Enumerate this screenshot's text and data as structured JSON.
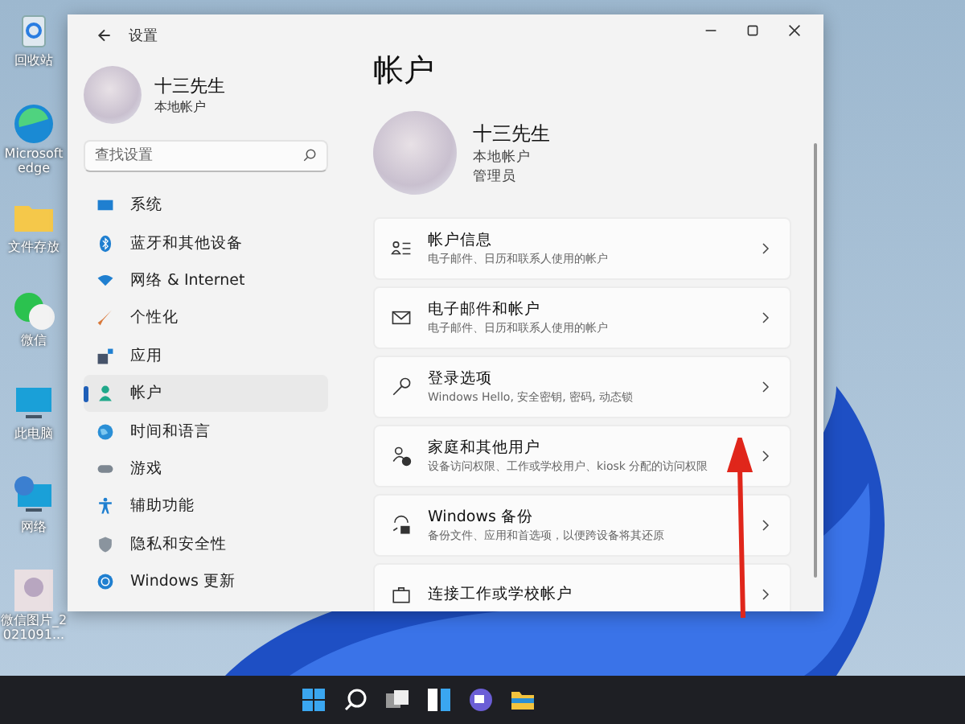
{
  "desktop_icons": [
    {
      "label": "回收站"
    },
    {
      "label": "Microsoft edge"
    },
    {
      "label": "文件存放"
    },
    {
      "label": "微信"
    },
    {
      "label": "此电脑"
    },
    {
      "label": "网络"
    },
    {
      "label": "微信图片_2021091..."
    }
  ],
  "window": {
    "title": "设置"
  },
  "sidebar": {
    "user": {
      "name": "十三先生",
      "account_type": "本地帐户"
    },
    "search": {
      "placeholder": "查找设置"
    },
    "items": [
      {
        "label": "系统",
        "selected": false
      },
      {
        "label": "蓝牙和其他设备",
        "selected": false
      },
      {
        "label": "网络 & Internet",
        "selected": false
      },
      {
        "label": "个性化",
        "selected": false
      },
      {
        "label": "应用",
        "selected": false
      },
      {
        "label": "帐户",
        "selected": true
      },
      {
        "label": "时间和语言",
        "selected": false
      },
      {
        "label": "游戏",
        "selected": false
      },
      {
        "label": "辅助功能",
        "selected": false
      },
      {
        "label": "隐私和安全性",
        "selected": false
      },
      {
        "label": "Windows 更新",
        "selected": false
      }
    ]
  },
  "page": {
    "title": "帐户",
    "user": {
      "name": "十三先生",
      "account_type": "本地帐户",
      "role": "管理员"
    },
    "cards": [
      {
        "title": "帐户信息",
        "subtitle": "电子邮件、日历和联系人使用的帐户"
      },
      {
        "title": "电子邮件和帐户",
        "subtitle": "电子邮件、日历和联系人使用的帐户"
      },
      {
        "title": "登录选项",
        "subtitle": "Windows Hello, 安全密钥, 密码, 动态锁"
      },
      {
        "title": "家庭和其他用户",
        "subtitle": "设备访问权限、工作或学校用户、kiosk 分配的访问权限"
      },
      {
        "title": "Windows 备份",
        "subtitle": "备份文件、应用和首选项，以便跨设备将其还原"
      },
      {
        "title": "连接工作或学校帐户"
      }
    ]
  }
}
